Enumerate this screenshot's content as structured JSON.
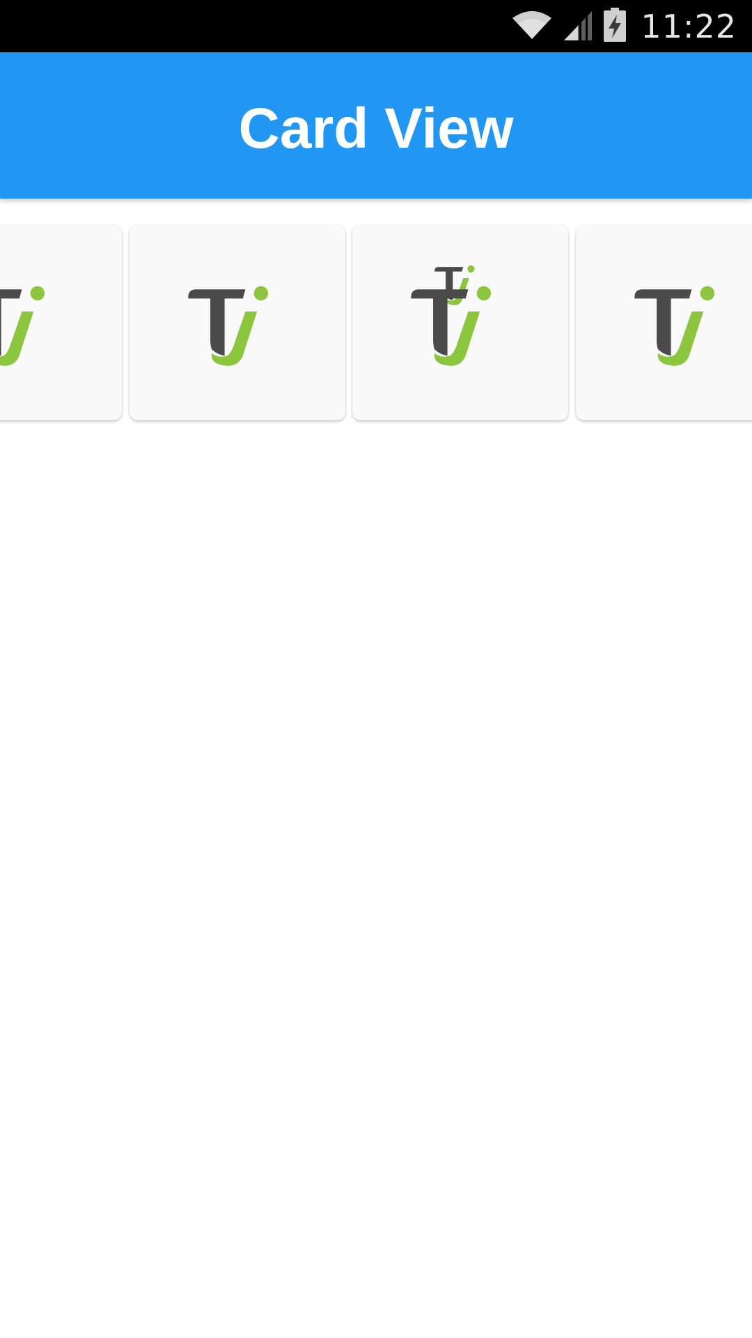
{
  "status_bar": {
    "time": "11:22",
    "icons": [
      "wifi-icon",
      "cell-signal-icon",
      "battery-charging-icon"
    ]
  },
  "app_bar": {
    "title": "Card View",
    "color": "#2196F3"
  },
  "cards": [
    {
      "logo": "ti-logo"
    },
    {
      "logo": "ti-logo"
    },
    {
      "logo": "ti-logo"
    },
    {
      "logo": "ti-logo"
    }
  ],
  "colors": {
    "logo_dark": "#4a4a4a",
    "logo_green": "#8cc63f",
    "card_bg": "#f9f9f9"
  }
}
